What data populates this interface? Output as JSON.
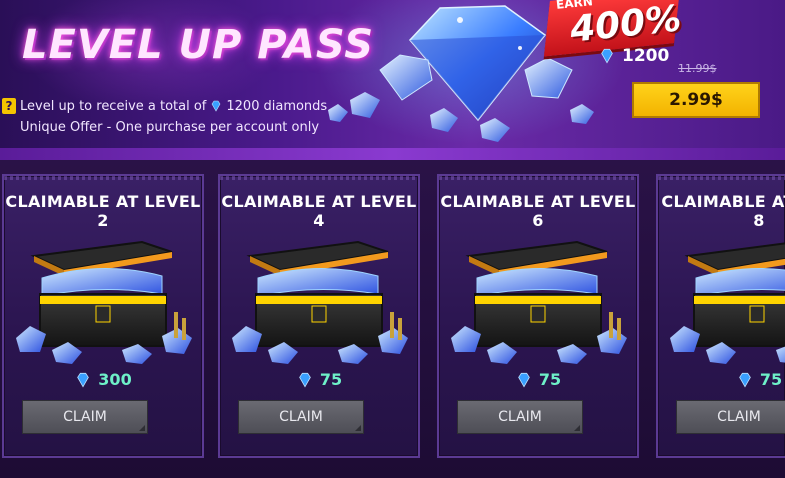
{
  "banner": {
    "title": "LEVEL UP PASS",
    "info_prefix": "Level up to receive a total of",
    "info_amount": "1200",
    "info_suffix": "diamonds",
    "unique_offer": "Unique Offer - One purchase per account only",
    "ribbon_small": "EARN",
    "ribbon_percent": "400%",
    "diamond_total": "1200",
    "old_price": "11.99$",
    "price": "2.99$"
  },
  "cards": [
    {
      "title_line1": "CLAIMABLE AT LEVEL",
      "level": "2",
      "reward": "300",
      "button": "CLAIM"
    },
    {
      "title_line1": "CLAIMABLE AT LEVEL",
      "level": "4",
      "reward": "75",
      "button": "CLAIM"
    },
    {
      "title_line1": "CLAIMABLE AT LEVEL",
      "level": "6",
      "reward": "75",
      "button": "CLAIM"
    },
    {
      "title_line1": "CLAIMABLE AT LEVEL",
      "level": "8",
      "reward": "75",
      "button": "CLAIM"
    }
  ],
  "colors": {
    "accent_yellow": "#f3b300",
    "reward_text": "#6ef0c8",
    "diamond_blue": "#3aa0ff",
    "ribbon_red": "#d51a22"
  },
  "icons": [
    "question-icon",
    "diamond-icon",
    "treasure-chest-icon",
    "gem-cluster-icon"
  ]
}
